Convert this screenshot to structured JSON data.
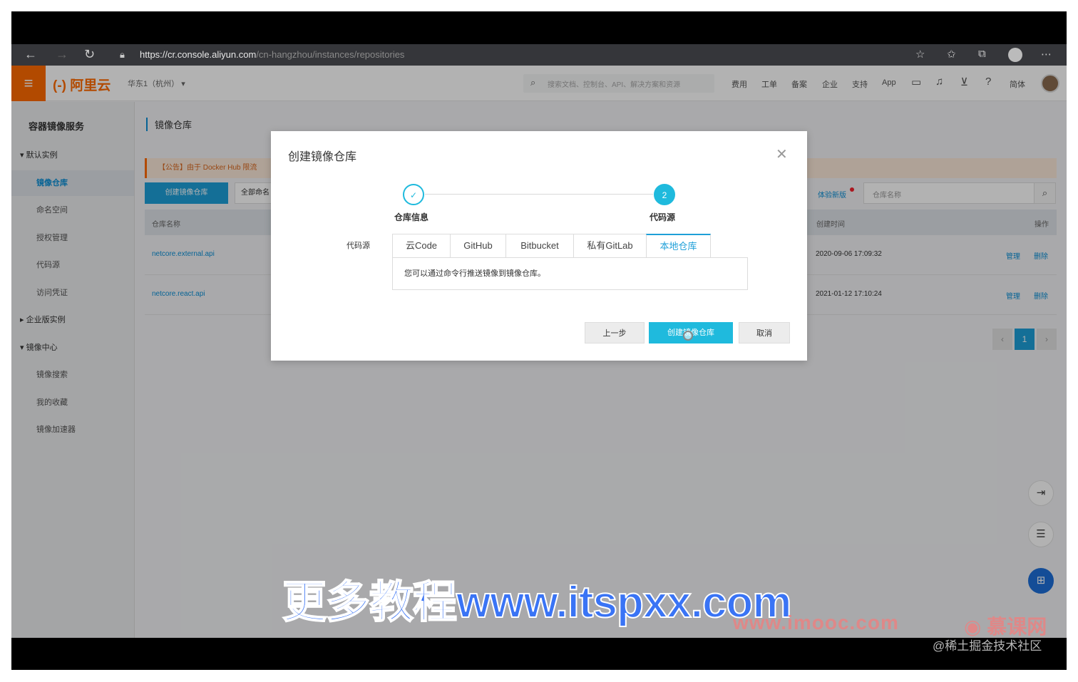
{
  "browser": {
    "url_host": "https://cr.console.aliyun.com",
    "url_path": "/cn-hangzhou/instances/repositories"
  },
  "topnav": {
    "logo": "(-) 阿里云",
    "region": "华东1（杭州）",
    "search_placeholder": "搜索文档、控制台、API、解决方案和资源",
    "items": [
      "费用",
      "工单",
      "备案",
      "企业",
      "支持",
      "App"
    ],
    "lang": "简体"
  },
  "sidebar": {
    "title": "容器镜像服务",
    "items": [
      {
        "label": "默认实例",
        "type": "group",
        "arrow": "▾"
      },
      {
        "label": "镜像仓库",
        "type": "item",
        "active": true
      },
      {
        "label": "命名空间",
        "type": "item"
      },
      {
        "label": "授权管理",
        "type": "item"
      },
      {
        "label": "代码源",
        "type": "item"
      },
      {
        "label": "访问凭证",
        "type": "item"
      },
      {
        "label": "企业版实例",
        "type": "group",
        "arrow": "▸"
      },
      {
        "label": "镜像中心",
        "type": "group",
        "arrow": "▾"
      },
      {
        "label": "镜像搜索",
        "type": "item"
      },
      {
        "label": "我的收藏",
        "type": "item"
      },
      {
        "label": "镜像加速器",
        "type": "item"
      }
    ]
  },
  "content": {
    "breadcrumb": "镜像仓库",
    "notice": "【公告】由于 Docker Hub 限流",
    "create_button": "创建镜像仓库",
    "namespace_select": "全部命名",
    "experience_link": "体验新版",
    "repo_search_placeholder": "仓库名称",
    "table": {
      "headers": {
        "name": "仓库名称",
        "created": "创建时间",
        "ops": "操作"
      },
      "rows": [
        {
          "name": "netcore.external.api",
          "created": "2020-09-06 17:09:32",
          "manage": "管理",
          "delete": "删除"
        },
        {
          "name": "netcore.react.api",
          "created": "2021-01-12 17:10:24",
          "manage": "管理",
          "delete": "删除"
        }
      ]
    },
    "pager": {
      "prev": "‹",
      "current": "1",
      "next": "›"
    }
  },
  "modal": {
    "title": "创建镜像仓库",
    "steps": [
      {
        "label": "仓库信息",
        "state": "done"
      },
      {
        "label": "代码源",
        "state": "current",
        "number": "2"
      }
    ],
    "source_label": "代码源",
    "tabs": [
      "云Code",
      "GitHub",
      "Bitbucket",
      "私有GitLab",
      "本地仓库"
    ],
    "active_tab": "本地仓库",
    "tab_panel_text": "您可以通过命令行推送镜像到镜像仓库。",
    "buttons": {
      "prev": "上一步",
      "create": "创建镜像仓库",
      "cancel": "取消"
    }
  },
  "watermarks": {
    "main": "更多教程www.itspxx.com",
    "imooc": "www.imooc.com",
    "imooc_logo": "慕课网",
    "credit": "@稀土掘金技术社区"
  },
  "colors": {
    "brand_orange": "#ff6a00",
    "accent_blue": "#1e9fd8",
    "primary_button": "#1fbadd"
  }
}
